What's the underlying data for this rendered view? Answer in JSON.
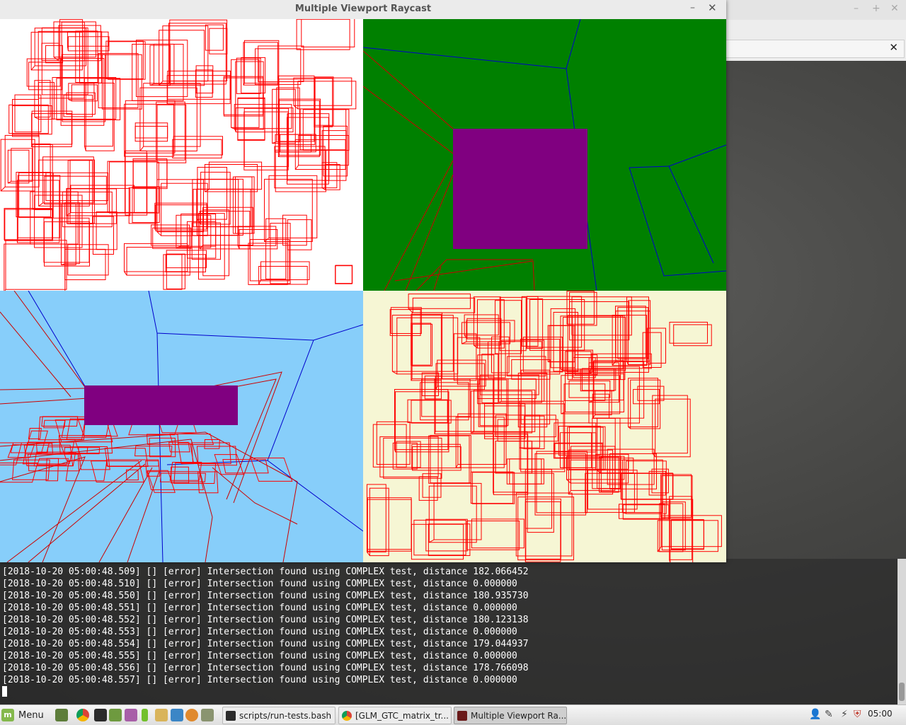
{
  "window": {
    "title": "Multiple Viewport Raycast",
    "minimize_glyph": "–",
    "close_glyph": "✕"
  },
  "background_window": {
    "minimize_glyph": "–",
    "maximize_glyph": "+",
    "close_glyph": "✕",
    "tab_close_glyph": "✕"
  },
  "viewports": [
    {
      "name": "top-left",
      "background": "#ffffff"
    },
    {
      "name": "top-right",
      "background": "#008000",
      "box_color": "#800080"
    },
    {
      "name": "bottom-left",
      "background": "#87cefa",
      "box_color": "#800080"
    },
    {
      "name": "bottom-right",
      "background": "#f6f6d4"
    }
  ],
  "colors": {
    "wireframe": "#ff0000",
    "wireframe_blue": "#0000cc",
    "terminal_text": "#ffffff",
    "taskbar": "#e8e8e8"
  },
  "terminal": {
    "lines": [
      "[2018-10-20 05:00:48.509] [] [error] Intersection found using COMPLEX test, distance 182.066452",
      "[2018-10-20 05:00:48.510] [] [error] Intersection found using COMPLEX test, distance 0.000000",
      "[2018-10-20 05:00:48.550] [] [error] Intersection found using COMPLEX test, distance 180.935730",
      "[2018-10-20 05:00:48.551] [] [error] Intersection found using COMPLEX test, distance 0.000000",
      "[2018-10-20 05:00:48.552] [] [error] Intersection found using COMPLEX test, distance 180.123138",
      "[2018-10-20 05:00:48.553] [] [error] Intersection found using COMPLEX test, distance 0.000000",
      "[2018-10-20 05:00:48.554] [] [error] Intersection found using COMPLEX test, distance 179.044937",
      "[2018-10-20 05:00:48.555] [] [error] Intersection found using COMPLEX test, distance 0.000000",
      "[2018-10-20 05:00:48.556] [] [error] Intersection found using COMPLEX test, distance 178.766098",
      "[2018-10-20 05:00:48.557] [] [error] Intersection found using COMPLEX test, distance 0.000000"
    ]
  },
  "taskbar": {
    "menu_label": "Menu",
    "launchers": [
      "desktop-icon",
      "chrome-icon",
      "terminal-icon",
      "files-icon",
      "image-viewer-icon",
      "battery-icon",
      "text-editor-icon",
      "network-icon",
      "search-icon",
      "photos-icon"
    ],
    "tasks": [
      {
        "label": "scripts/run-tests.bash",
        "icon": "terminal-icon",
        "active": false
      },
      {
        "label": "[GLM_GTC_matrix_tr...",
        "icon": "chrome-icon",
        "active": false
      },
      {
        "label": "Multiple Viewport Ra...",
        "icon": "app-icon",
        "active": true
      }
    ],
    "tray": [
      "user-icon",
      "network-icon",
      "shield-icon"
    ],
    "clock": "05:00"
  }
}
